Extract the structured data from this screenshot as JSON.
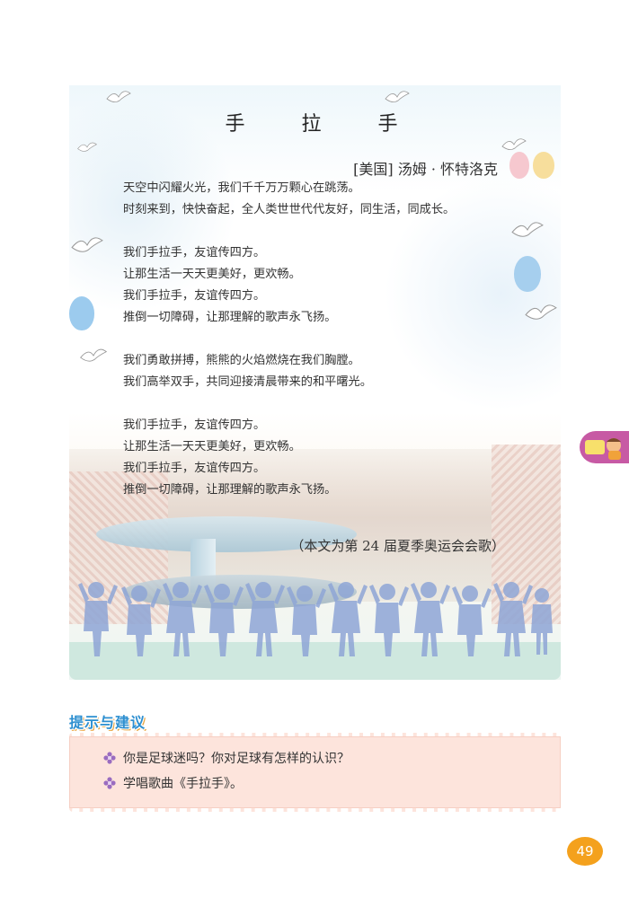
{
  "song": {
    "title": "手 拉 手",
    "author": "[美国] 汤姆 · 怀特洛克",
    "stanzas": [
      [
        "天空中闪耀火光，我们千千万万颗心在跳荡。",
        "时刻来到，快快奋起，全人类世世代代友好，同生活，同成长。"
      ],
      [
        "我们手拉手，友谊传四方。",
        "让那生活一天天更美好，更欢畅。",
        "我们手拉手，友谊传四方。",
        "推倒一切障碍，让那理解的歌声永飞扬。"
      ],
      [
        "我们勇敢拼搏，熊熊的火焰燃烧在我们胸膛。",
        "我们高举双手，共同迎接清晨带来的和平曙光。"
      ],
      [
        "我们手拉手，友谊传四方。",
        "让那生活一天天更美好，更欢畅。",
        "我们手拉手，友谊传四方。",
        "推倒一切障碍，让那理解的歌声永飞扬。"
      ]
    ],
    "note": "（本文为第 24 届夏季奥运会会歌）"
  },
  "tips": {
    "heading": "提示与建议",
    "items": [
      "你是足球迷吗？你对足球有怎样的认识？",
      "学唱歌曲《手拉手》。"
    ]
  },
  "page_number": "49",
  "colors": {
    "tab": "#c75aa4",
    "page_badge": "#f4a11d",
    "heading": "#2d8fd0",
    "hint_bg": "#fde4dc",
    "kids": "#8fa6d6"
  },
  "icons": {
    "bullet": "flower-icon",
    "side_tab": "boy-reading-icon"
  }
}
